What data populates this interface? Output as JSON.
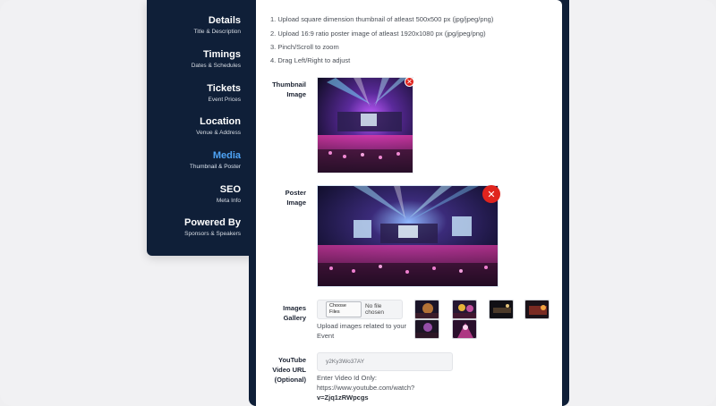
{
  "sidebar": {
    "items": [
      {
        "title": "Details",
        "subtitle": "Title & Description"
      },
      {
        "title": "Timings",
        "subtitle": "Dates & Schedules"
      },
      {
        "title": "Tickets",
        "subtitle": "Event Prices"
      },
      {
        "title": "Location",
        "subtitle": "Venue & Address"
      },
      {
        "title": "Media",
        "subtitle": "Thumbnail & Poster"
      },
      {
        "title": "SEO",
        "subtitle": "Meta Info"
      },
      {
        "title": "Powered By",
        "subtitle": "Sponsors & Speakers"
      }
    ],
    "active_color": "#4ea3f5",
    "background": "#0f1f38"
  },
  "instructions": [
    "1. Upload square dimension thumbnail of atleast 500x500 px (jpg/jpeg/png)",
    "2. Upload 16:9 ratio poster image of atleast 1920x1080 px (jpg/jpeg/png)",
    "3. Pinch/Scroll to zoom",
    "4. Drag Left/Right to adjust"
  ],
  "thumbnail": {
    "label_line1": "Thumbnail",
    "label_line2": "Image",
    "remove_icon": "close-icon"
  },
  "poster": {
    "label_line1": "Poster",
    "label_line2": "Image",
    "remove_icon": "close-icon"
  },
  "gallery": {
    "label_line1": "Images",
    "label_line2": "Gallery",
    "choose_files": "Choose Files",
    "no_file": "No file chosen",
    "help_line1": "Upload images related to your",
    "help_line2": "Event"
  },
  "youtube": {
    "label_line1": "YouTube",
    "label_line2": "Video URL",
    "label_line3": "(Optional)",
    "placeholder": "y2Ky3Wo37AY",
    "help_line1": "Enter Video Id Only:",
    "help_line2": "https://www.youtube.com/watch?",
    "help_line3": "v=Zjq1zRWpcgs"
  },
  "colors": {
    "accent": "#4ea3f5",
    "remove": "#e0241e",
    "panel_border": "#0f1f38"
  }
}
